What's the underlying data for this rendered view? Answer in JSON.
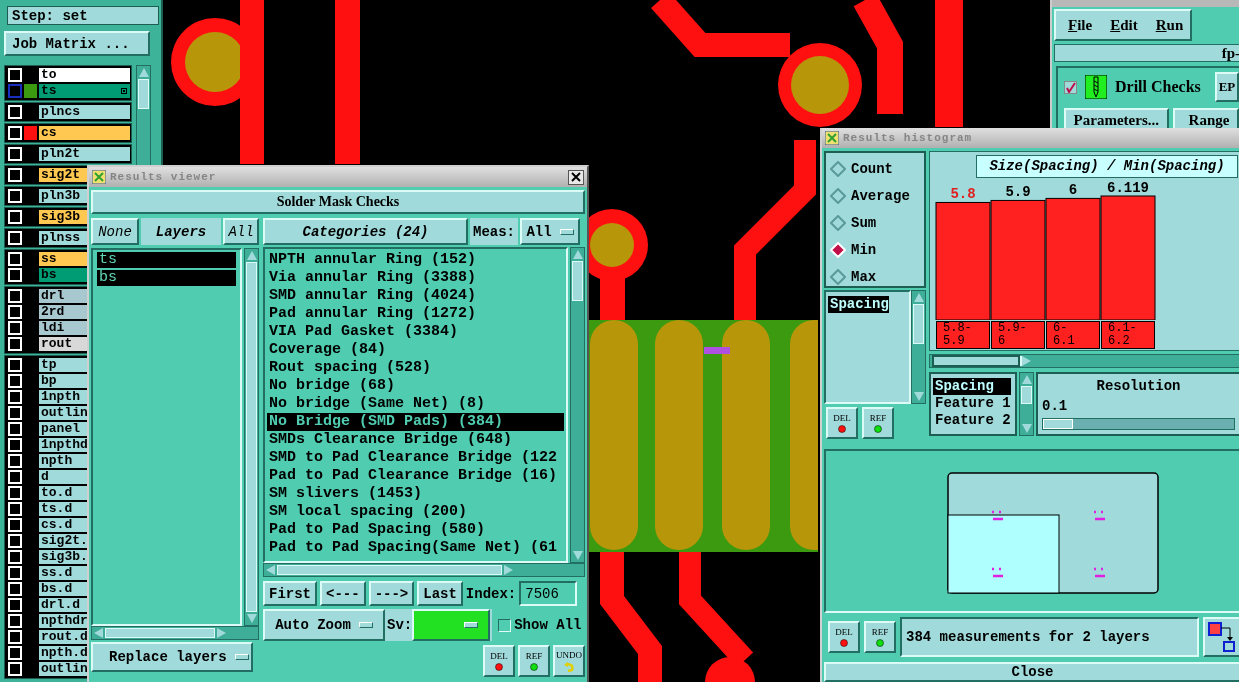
{
  "layer_panel": {
    "step": "Step: set",
    "job_matrix_button": "Job Matrix ...",
    "groups": [
      {
        "items": [
          {
            "name": "to",
            "color": "#ffffff",
            "selected": false
          },
          {
            "name": "ts",
            "color": "#009c74",
            "swatch": {
              "color": "#3c9a10"
            },
            "selected": true
          }
        ]
      },
      {
        "items": [
          {
            "name": "plncs",
            "color": "#a0dada",
            "selected": false
          }
        ]
      },
      {
        "items": [
          {
            "name": "cs",
            "color": "#ffc850",
            "swatch": {
              "color": "#ff1010"
            },
            "selected": false
          }
        ]
      },
      {
        "items": [
          {
            "name": "pln2t",
            "color": "#a0dada",
            "selected": false
          }
        ]
      },
      {
        "items": [
          {
            "name": "sig2t",
            "color": "#ffc850",
            "selected": false
          }
        ]
      },
      {
        "items": [
          {
            "name": "pln3b",
            "color": "#a0dada",
            "selected": false
          }
        ]
      },
      {
        "items": [
          {
            "name": "sig3b",
            "color": "#ffc850",
            "selected": false
          }
        ]
      },
      {
        "items": [
          {
            "name": "plnss",
            "color": "#a0dada",
            "selected": false
          }
        ]
      },
      {
        "items": [
          {
            "name": "ss",
            "color": "#ffc850",
            "selected": false
          },
          {
            "name": "bs",
            "color": "#009c74",
            "selected": false
          }
        ]
      },
      {
        "items": [
          {
            "name": "drl",
            "color": "#a8c8d0",
            "selected": false
          },
          {
            "name": "2rd",
            "color": "#a8c8d0",
            "selected": false
          },
          {
            "name": "ldi",
            "color": "#a8c8d0",
            "selected": false
          },
          {
            "name": "rout",
            "color": "#d8d8d8",
            "selected": false
          }
        ]
      },
      {
        "items": [
          {
            "name": "tp",
            "color": "#a0dada",
            "selected": false
          },
          {
            "name": "bp",
            "color": "#a0dada",
            "selected": false
          },
          {
            "name": "1npth",
            "color": "#a0dada",
            "selected": false
          },
          {
            "name": "outlin",
            "color": "#a0dada",
            "selected": false
          },
          {
            "name": "panel",
            "color": "#a0dada",
            "selected": false
          },
          {
            "name": "1npthd",
            "color": "#a0dada",
            "selected": false
          },
          {
            "name": "npth",
            "color": "#a0dada",
            "selected": false
          },
          {
            "name": "d",
            "color": "#a0dada",
            "selected": false
          },
          {
            "name": "to.d",
            "color": "#a0dada",
            "selected": false
          },
          {
            "name": "ts.d",
            "color": "#a0dada",
            "selected": false
          },
          {
            "name": "cs.d",
            "color": "#a0dada",
            "selected": false
          },
          {
            "name": "sig2t.",
            "color": "#a0dada",
            "selected": false
          },
          {
            "name": "sig3b.",
            "color": "#a0dada",
            "selected": false
          },
          {
            "name": "ss.d",
            "color": "#a0dada",
            "selected": false
          },
          {
            "name": "bs.d",
            "color": "#a0dada",
            "selected": false
          },
          {
            "name": "drl.d",
            "color": "#a0dada",
            "selected": false
          },
          {
            "name": "npthdr",
            "color": "#a0dada",
            "selected": false
          },
          {
            "name": "rout.d",
            "color": "#a0dada",
            "selected": false
          },
          {
            "name": "npth.d",
            "color": "#a0dada",
            "selected": false
          },
          {
            "name": "outlin",
            "color": "#a0dada",
            "selected": false
          }
        ]
      }
    ]
  },
  "checklist": {
    "menus": [
      "File",
      "Edit",
      "Run"
    ],
    "job_label": "fp-",
    "check": {
      "label": "Drill Checks",
      "checked": true
    },
    "ep_button": "EP",
    "parameters_button": "Parameters...",
    "range_button": "Range"
  },
  "results_viewer": {
    "title": "Results viewer",
    "header": "Solder Mask Checks",
    "none_button": "None",
    "layers_label": "Layers",
    "all_button": "All",
    "layers": [
      {
        "name": "ts",
        "selected": true
      },
      {
        "name": "bs",
        "selected": true
      }
    ],
    "categories_button": "Categories (24)",
    "meas_label": "Meas:",
    "meas_value": "All",
    "categories": [
      {
        "label": "NPTH annular Ring (152)",
        "selected": false
      },
      {
        "label": "Via annular Ring (3388)",
        "selected": false
      },
      {
        "label": "SMD annular Ring (4024)",
        "selected": false
      },
      {
        "label": "Pad annular Ring (1272)",
        "selected": false
      },
      {
        "label": "VIA Pad Gasket (3384)",
        "selected": false
      },
      {
        "label": "Coverage (84)",
        "selected": false
      },
      {
        "label": "Rout spacing (528)",
        "selected": false
      },
      {
        "label": "No bridge (68)",
        "selected": false
      },
      {
        "label": "No bridge (Same Net) (8)",
        "selected": false
      },
      {
        "label": "No Bridge (SMD Pads) (384)",
        "selected": true
      },
      {
        "label": "SMDs Clearance Bridge (648)",
        "selected": false
      },
      {
        "label": "SMD to Pad Clearance Bridge (122",
        "selected": false
      },
      {
        "label": "Pad to Pad Clearance Bridge (16)",
        "selected": false
      },
      {
        "label": "SM slivers (1453)",
        "selected": false
      },
      {
        "label": "SM local spacing (200)",
        "selected": false
      },
      {
        "label": "Pad to Pad Spacing (580)",
        "selected": false
      },
      {
        "label": "Pad to Pad Spacing(Same Net) (61",
        "selected": false
      }
    ],
    "nav_buttons": [
      "First",
      "<---",
      "--->",
      "Last"
    ],
    "index_label": "Index:",
    "index_value": "7506",
    "zoom_menu": "Auto Zoom",
    "sv_label": "Sv:",
    "show_all": {
      "label": "Show All",
      "checked": false
    },
    "replace_menu": "Replace layers",
    "tool_buttons": [
      {
        "label": "DEL",
        "kind": "delete"
      },
      {
        "label": "REF",
        "kind": "ref"
      },
      {
        "label": "UNDO",
        "kind": "undo"
      }
    ]
  },
  "histogram": {
    "title": "Results histogram",
    "modes": [
      {
        "label": "Count",
        "selected": false
      },
      {
        "label": "Average",
        "selected": false
      },
      {
        "label": "Sum",
        "selected": false
      },
      {
        "label": "Min",
        "selected": true
      },
      {
        "label": "Max",
        "selected": false
      }
    ],
    "fields": [
      {
        "label": "Spacing",
        "selected": true
      }
    ],
    "tool_buttons": [
      {
        "label": "DEL",
        "kind": "delete"
      },
      {
        "label": "REF",
        "kind": "ref"
      }
    ],
    "chart_data": {
      "type": "bar",
      "title": "Size(Spacing) / Min(Spacing)",
      "categories": [
        "5.8-\n5.9",
        "5.9-\n6",
        "6-\n6.1",
        "6.1-\n6.2"
      ],
      "values": [
        5.8,
        5.9,
        6,
        6.119
      ],
      "data_labels": true
    },
    "attributes": [
      {
        "label": "Spacing",
        "selected": true
      },
      {
        "label": "Feature 1",
        "selected": false
      },
      {
        "label": "Feature 2",
        "selected": false
      }
    ],
    "resolution_label": "Resolution",
    "resolution_value": "0.1",
    "resolution_slider": {
      "level": 0
    },
    "bottom_tool_buttons": [
      {
        "label": "DEL",
        "kind": "delete"
      },
      {
        "label": "REF",
        "kind": "ref"
      }
    ],
    "status": "384 measurements for 2 layers",
    "close_button": "Close"
  }
}
